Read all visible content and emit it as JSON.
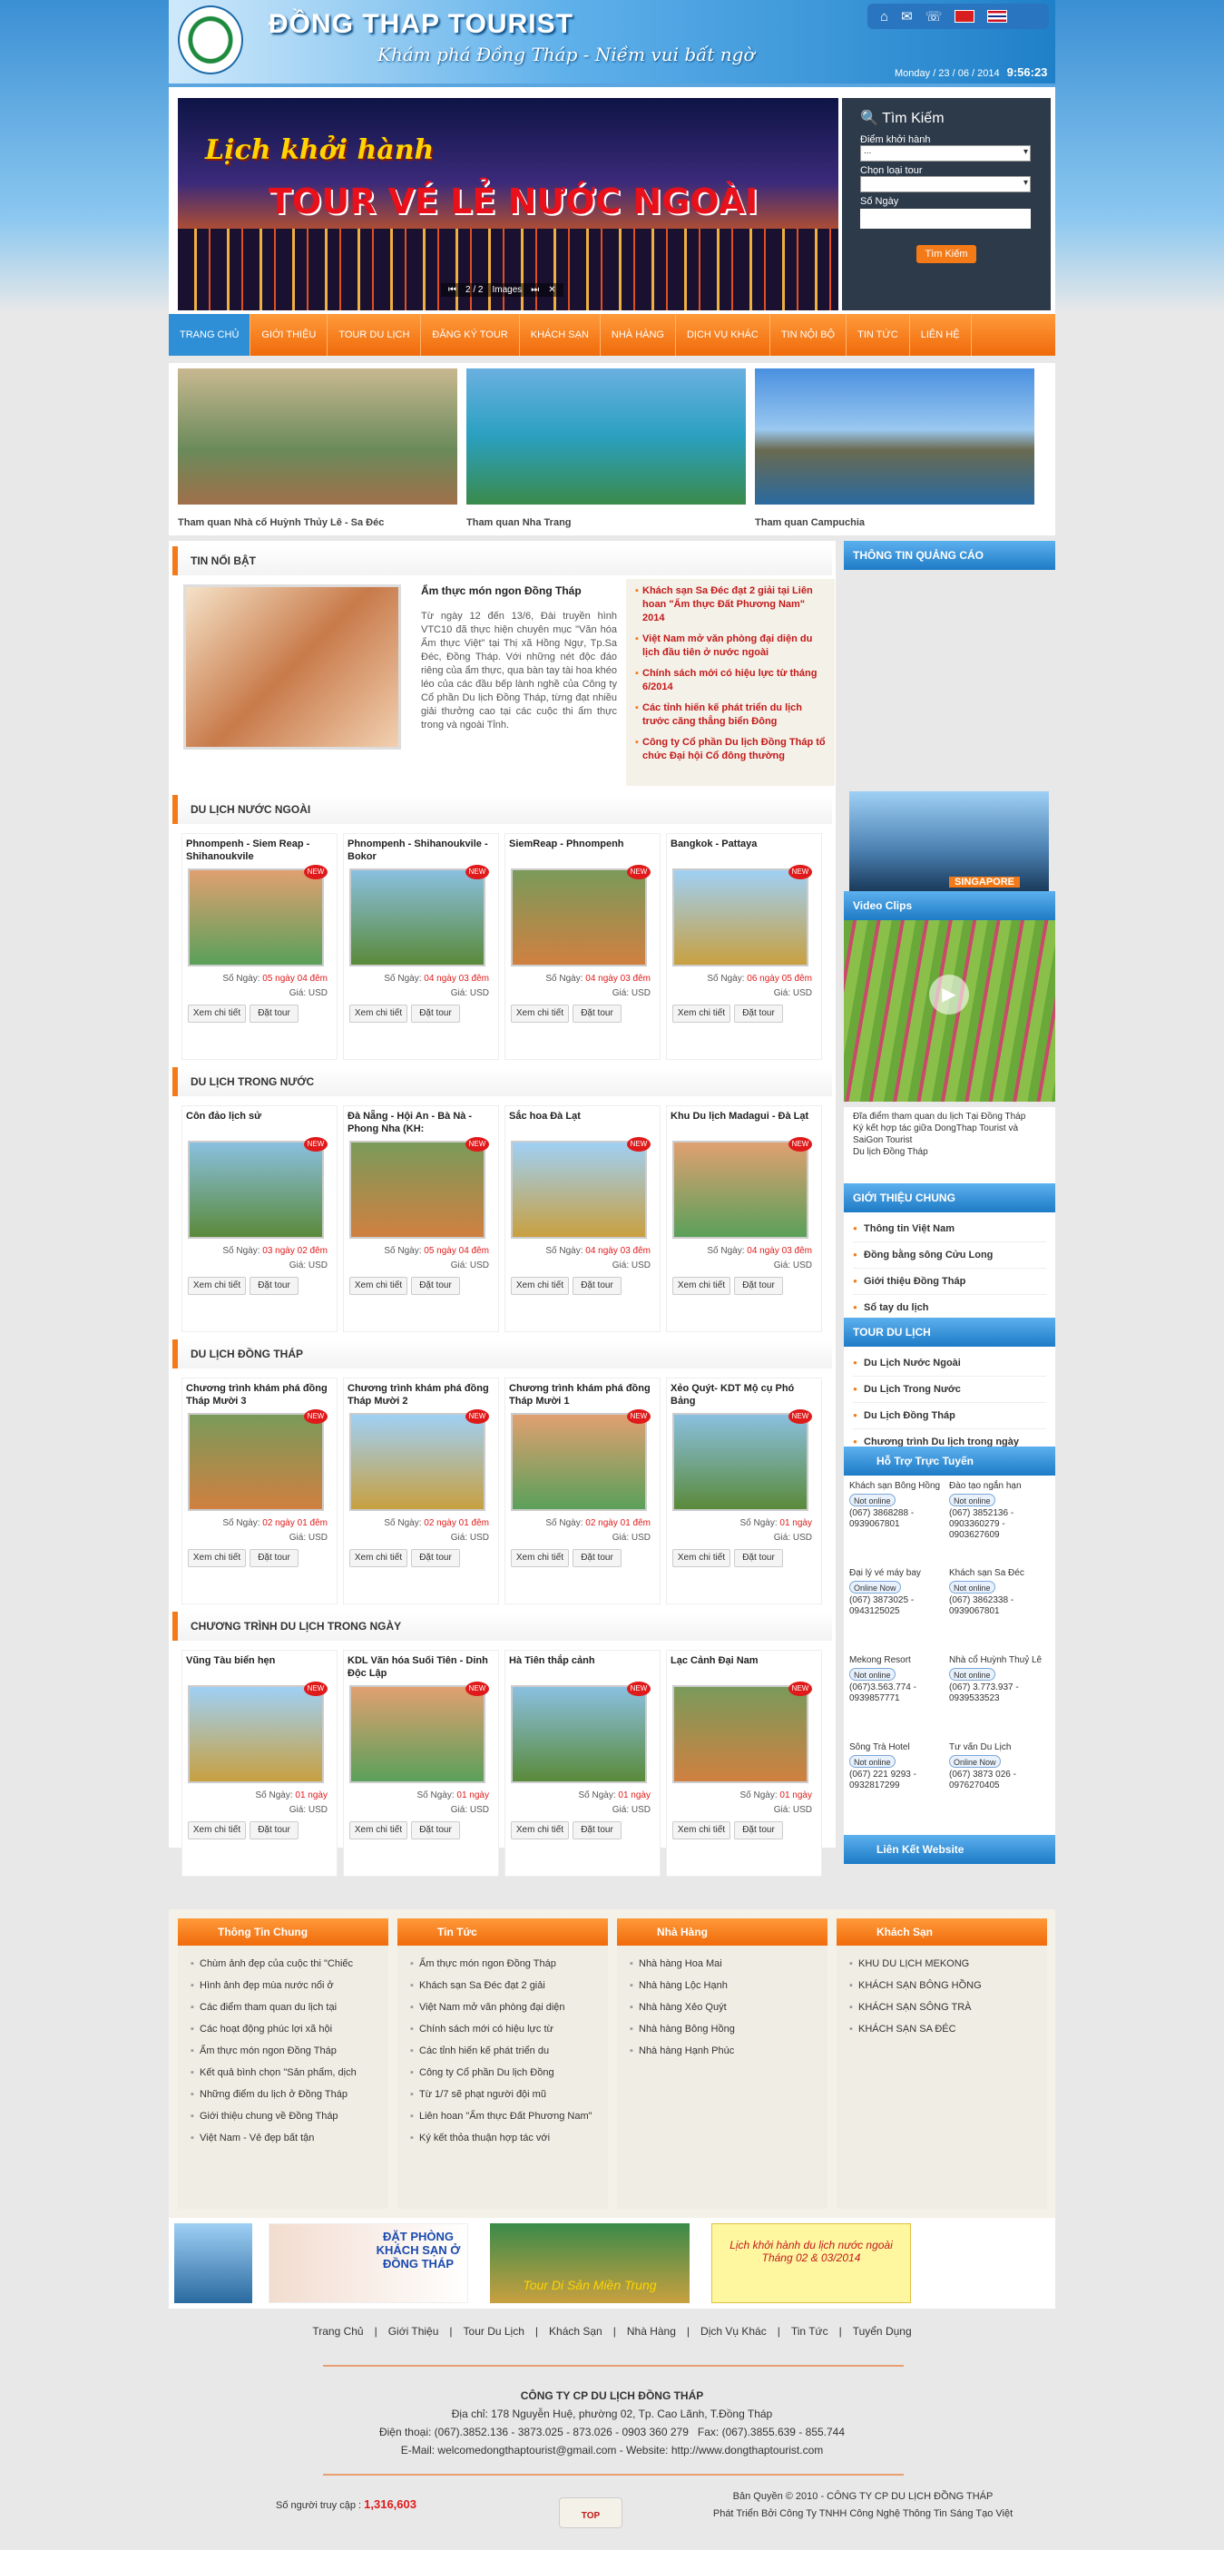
{
  "header": {
    "title": "ĐỒNG THAP TOURIST",
    "slogan": "Khám phá Đồng Tháp - Niềm vui bất ngờ",
    "date": "Monday / 23 / 06 / 2014",
    "time": "9:56:23"
  },
  "slide": {
    "line1": "Lịch khởi hành",
    "line2": "TOUR VÉ LẺ NƯỚC NGOÀI",
    "pager": "2 / 2",
    "pager_label": "Images"
  },
  "search": {
    "title": "Tìm Kiếm",
    "f1": "Điểm khởi hành",
    "f1v": "...",
    "f2": "Chọn loại tour",
    "f2v": "",
    "f3": "Số Ngày",
    "button": "Tìm Kiếm"
  },
  "nav": [
    "TRANG CHỦ",
    "GIỚI THIỆU",
    "TOUR DU LỊCH",
    "ĐĂNG KÝ TOUR",
    "KHÁCH SẠN",
    "NHÀ HÀNG",
    "DỊCH VỤ KHÁC",
    "TIN NỘI BỘ",
    "TIN TỨC",
    "LIÊN HỆ"
  ],
  "gallery": [
    "Tham quan Nhà cổ Huỳnh Thủy Lê - Sa Đéc",
    "Tham quan Nha Trang",
    "Tham quan Campuchia"
  ],
  "featured": {
    "section": "TIN NỔI BẬT",
    "title": "Ẩm thực món ngon Đồng Tháp",
    "text": "Từ ngày 12 đến 13/6, Đài truyền hình VTC10 đã thực hiện chuyên mục \"Văn hóa Ẩm thực Việt\" tại Thị xã Hồng Ngự, Tp.Sa Đéc, Đồng Tháp. Với những nét độc đáo riêng của ẩm thực, qua bàn tay tài hoa khéo léo của các đầu bếp lành nghề của Công ty Cổ phần Du lịch Đồng Tháp, từng đạt nhiều giải thưởng cao tại các cuộc thi ẩm thực trong và ngoài Tỉnh.",
    "links": [
      "Khách sạn Sa Đéc đạt 2 giải tại Liên hoan \"Ẩm thực Đất Phương Nam\" 2014",
      "Việt Nam mở văn phòng đại diện du lịch đầu tiên ở nước ngoài",
      "Chính sách mới có hiệu lực từ tháng 6/2014",
      "Các tỉnh hiến kế phát triển du lịch trước căng thẳng biển Đông",
      "Công ty Cổ phần Du lịch Đồng Tháp tổ chức Đại hội Cổ đông thường"
    ]
  },
  "sections": [
    {
      "title": "DU LỊCH NƯỚC NGOÀI",
      "tours": [
        {
          "name": "Phnompenh - Siem Reap - Shihanoukvile",
          "days": "05 ngày 04 đêm"
        },
        {
          "name": "Phnompenh - Shihanoukvile - Bokor",
          "days": "04 ngày 03 đêm"
        },
        {
          "name": "SiemReap - Phnompenh",
          "days": "04 ngày 03 đêm"
        },
        {
          "name": "Bangkok - Pattaya",
          "days": "06 ngày 05 đêm"
        }
      ]
    },
    {
      "title": "DU LỊCH TRONG NƯỚC",
      "tours": [
        {
          "name": "Côn đảo lịch sử",
          "days": "03 ngày 02 đêm"
        },
        {
          "name": "Đà Nẵng - Hội An - Bà Nà - Phong Nha (KH:",
          "days": "05 ngày 04 đêm"
        },
        {
          "name": "Sắc hoa Đà Lạt",
          "days": "04 ngày 03 đêm"
        },
        {
          "name": "Khu Du lịch Madagui - Đà Lạt",
          "days": "04 ngày 03 đêm"
        }
      ]
    },
    {
      "title": "DU LỊCH ĐỒNG THÁP",
      "tours": [
        {
          "name": "Chương trình khám phá đồng Tháp Mười 3",
          "days": "02 ngày 01 đêm"
        },
        {
          "name": "Chương trình khám phá đồng Tháp Mười 2",
          "days": "02 ngày 01 đêm"
        },
        {
          "name": "Chương trình khám phá đồng Tháp Mười 1",
          "days": "02 ngày 01 đêm"
        },
        {
          "name": "Xẻo Quýt- KDT Mộ cụ Phó Bảng",
          "days": "01 ngày"
        }
      ]
    },
    {
      "title": "CHƯƠNG TRÌNH DU LỊCH TRONG NGÀY",
      "tours": [
        {
          "name": "Vũng Tàu biển hẹn",
          "days": "01 ngày"
        },
        {
          "name": "KDL Văn hóa Suối Tiên - Dinh Độc Lập",
          "days": "01 ngày"
        },
        {
          "name": "Hà Tiên thắp cảnh",
          "days": "01 ngày"
        },
        {
          "name": "Lạc Cảnh Đại Nam",
          "days": "01 ngày"
        }
      ]
    }
  ],
  "labels": {
    "days": "Số Ngày:",
    "price": "Giá: USD",
    "detail": "Xem chi tiết",
    "book": "Đặt tour",
    "new": "NEW"
  },
  "side": {
    "ads": "THÔNG TIN QUẢNG CÁO",
    "ad_caption": "SINGAPORE",
    "video": "Video Clips",
    "video_list": [
      "Đĩa điểm tham quan du lịch Tại Đồng Tháp",
      "Ký kết hợp tác giữa DongThap Tourist và SaiGon Tourist",
      "Du lịch Đồng Tháp"
    ],
    "intro": "GIỚI THIỆU CHUNG",
    "intro_items": [
      "Thông tin Việt Nam",
      "Đồng bằng sông Cửu Long",
      "Giới thiệu Đồng Tháp",
      "Sổ tay du lịch"
    ],
    "tour": "TOUR DU LỊCH",
    "tour_items": [
      "Du Lịch Nước Ngoài",
      "Du Lịch Trong Nước",
      "Du Lịch Đồng Tháp",
      "Chương trình Du lịch trong ngày"
    ],
    "support": "Hỗ Trợ Trực Tuyến",
    "contacts": [
      {
        "name": "Khách sạn Bông Hồng",
        "status": "Not online",
        "phone": "(067) 3868288 - 0939067801"
      },
      {
        "name": "Đào tạo ngắn hạn",
        "status": "Not online",
        "phone": "(067) 3852136 - 0903360279 - 0903627609"
      },
      {
        "name": "Đại lý vé máy bay",
        "status": "Online Now",
        "phone": "(067) 3873025 - 0943125025"
      },
      {
        "name": "Khách sạn Sa Đéc",
        "status": "Not online",
        "phone": "(067) 3862338 - 0939067801"
      },
      {
        "name": "Mekong Resort",
        "status": "Not online",
        "phone": "(067)3.563.774 - 0939857771"
      },
      {
        "name": "Nhà cổ Huỳnh Thuỷ Lê",
        "status": "Not online",
        "phone": "(067) 3.773.937 - 0939533523"
      },
      {
        "name": "Sông Trà Hotel",
        "status": "Not online",
        "phone": "(067) 221 9293 - 0932817299"
      },
      {
        "name": "Tư vấn Du Lịch",
        "status": "Online Now",
        "phone": "(067) 3873 026 - 0976270405"
      }
    ],
    "links": "Liên Kết Website"
  },
  "footer_cols": [
    {
      "title": "Thông Tin Chung",
      "items": [
        "Chùm ảnh đẹp của cuộc thi \"Chiếc",
        "Hình ảnh đẹp mùa nước nổi ở",
        "Các điểm tham quan du lịch tại",
        "Các hoạt động phúc lợi xã hội",
        "Ẩm thực món ngon Đồng Tháp",
        "Kết quả bình chọn \"Sản phẩm, dịch",
        "Những điểm du lịch ở Đồng Tháp",
        "Giới thiệu chung về Đồng Tháp",
        "Việt Nam - Vẻ đẹp bất tận"
      ]
    },
    {
      "title": "Tin Tức",
      "items": [
        "Ẩm thực món ngon Đồng Tháp",
        "Khách sạn Sa Đéc đạt 2 giải",
        "Việt Nam mở văn phòng đại diện",
        "Chính sách mới có hiệu lực từ",
        "Các tỉnh hiến kế phát triển du",
        "Công ty Cổ phần Du lịch Đồng",
        "Từ 1/7 sẽ phạt người đội mũ",
        "Liên hoan \"Ẩm thực Đất Phương Nam\"",
        "Ký kết thỏa thuận hợp tác với"
      ]
    },
    {
      "title": "Nhà Hàng",
      "items": [
        "Nhà hàng Hoa Mai",
        "Nhà hàng Lộc Hạnh",
        "Nhà hàng Xẻo Quýt",
        "Nhà hàng Bông Hồng",
        "Nhà hàng Hạnh Phúc"
      ]
    },
    {
      "title": "Khách Sạn",
      "items": [
        "KHU DU LỊCH MEKONG",
        "KHÁCH SẠN BÔNG HỒNG",
        "KHÁCH SẠN SÔNG TRÀ",
        "KHÁCH SẠN SA ĐÉC"
      ]
    }
  ],
  "ads": {
    "a1": "ĐẶT PHÒNG KHÁCH SẠN Ở ĐỒNG THÁP",
    "a2": "Tour Di Sản Miền Trung",
    "a3": "Lịch khởi hành du lịch nước ngoài Tháng 02 & 03/2014"
  },
  "footnav": [
    "Trang Chủ",
    "Giới Thiệu",
    "Tour Du Lịch",
    "Khách Sạn",
    "Nhà Hàng",
    "Dịch Vụ Khác",
    "Tin Tức",
    "Tuyển Dụng"
  ],
  "address": {
    "company": "CÔNG TY CP DU LỊCH ĐỒNG THÁP",
    "addr": "Địa chỉ: 178 Nguyễn Huệ, phường 02, Tp. Cao Lãnh, T.Đồng Tháp",
    "phone": "Điện thoại: (067).3852.136 - 3873.025 - 873.026 - 0903 360 279",
    "fax": "Fax: (067).3855.639 - 855.744",
    "email": "E-Mail: welcomedongthaptourist@gmail.com - Website: http://www.dongthaptourist.com"
  },
  "counter": {
    "label": "Số người truy cập :",
    "value": "1,316,603"
  },
  "top": "TOP",
  "copyright": {
    "l1": "Bản Quyền © 2010 - CÔNG TY CP DU LỊCH ĐỒNG THÁP",
    "l2": "Phát Triển Bởi Công Ty TNHH Công Nghệ Thông Tin Sáng Tạo Việt"
  }
}
